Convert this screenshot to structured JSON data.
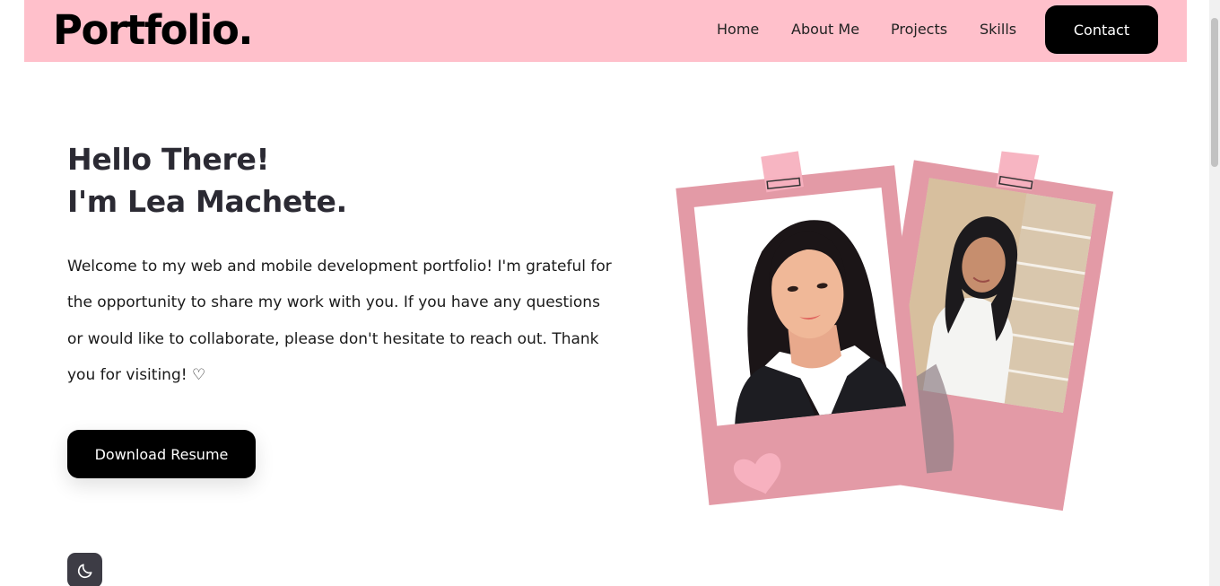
{
  "header": {
    "logo": "Portfolio.",
    "nav": [
      {
        "label": "Home"
      },
      {
        "label": "About Me"
      },
      {
        "label": "Projects"
      },
      {
        "label": "Skills"
      }
    ],
    "contact_label": "Contact"
  },
  "hero": {
    "greeting_line1": "Hello There!",
    "greeting_line2": "I'm Lea Machete.",
    "description": "Welcome to my web and mobile development portfolio! I'm grateful for the opportunity to share my work with you. If you have any questions or would like to collaborate, please don't hesitate to reach out. Thank you for visiting! ♡",
    "resume_label": "Download Resume"
  },
  "theme": {
    "toggle_icon": "moon-icon"
  },
  "colors": {
    "header_bg": "#ffc0cb",
    "button_bg": "#000000",
    "polaroid_pink": "#e39aa6",
    "tape_pink": "#f7b1bf",
    "heading": "#2b2a33"
  }
}
